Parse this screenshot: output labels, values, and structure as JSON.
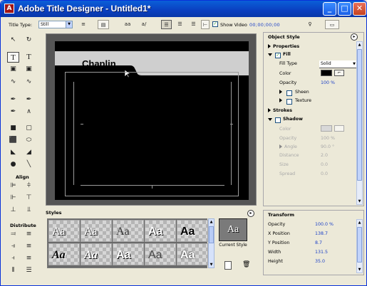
{
  "window": {
    "title": "Adobe Title Designer - Untitled1*",
    "app_icon": "adobe-icon",
    "controls": [
      "_",
      "□",
      "✕"
    ]
  },
  "toolbar": {
    "title_type_label": "Title Type:",
    "title_type_value": "Still",
    "show_video_label": "Show Video",
    "show_video_checked": true,
    "timecode": "00;00;00;00",
    "icons": [
      "roll-crawl-icon",
      "template-icon",
      "font-browse-icon",
      "kerning-icon",
      "align-left-icon",
      "align-center-icon",
      "align-right-icon",
      "tab-stops-icon",
      "light-bulb-icon",
      "export-icon"
    ]
  },
  "tools": {
    "align_label": "Align",
    "distribute_label": "Distribute",
    "items": [
      "selection-tool-icon",
      "rotation-tool-icon",
      "type-tool-icon",
      "vertical-type-tool-icon",
      "area-type-tool-icon",
      "vertical-area-type-tool-icon",
      "path-type-tool-icon",
      "vertical-path-type-tool-icon",
      "pen-tool-icon",
      "add-anchor-tool-icon",
      "delete-anchor-tool-icon",
      "convert-anchor-tool-icon",
      "rectangle-tool-icon",
      "rounded-rectangle-tool-icon",
      "clipped-corner-tool-icon",
      "rounded-corner-tool-icon",
      "wedge-tool-icon",
      "arc-tool-icon",
      "ellipse-tool-icon",
      "line-tool-icon"
    ]
  },
  "canvas": {
    "text": "Chaplin",
    "background": "#000000",
    "strip_color": "#cfcfcf"
  },
  "styles": {
    "label": "Styles",
    "swatches": [
      "Aa",
      "Aa",
      "Aa",
      "Aa",
      "Aa",
      "Aa",
      "Aa",
      "Aa",
      "Aa",
      "Aa"
    ],
    "current_style_label": "Current Style",
    "current_style_sample": "Aa"
  },
  "object_style": {
    "label": "Object Style",
    "properties_label": "Properties",
    "fill_label": "Fill",
    "fill_checked": true,
    "fill_type_label": "Fill Type",
    "fill_type_value": "Solid",
    "color_label": "Color",
    "color_value": "#000000",
    "opacity_label": "Opacity",
    "opacity_value": "100 %",
    "sheen_label": "Sheen",
    "texture_label": "Texture",
    "strokes_label": "Strokes",
    "shadow_label": "Shadow",
    "shadow_checked": false,
    "shadow_color_label": "Color",
    "shadow_opacity_label": "Opacity",
    "shadow_opacity_value": "100 %",
    "shadow_angle_label": "Angle",
    "shadow_angle_value": "90.0 °",
    "shadow_distance_label": "Distance",
    "shadow_distance_value": "2.0",
    "shadow_size_label": "Size",
    "shadow_size_value": "0.0",
    "shadow_spread_label": "Spread",
    "shadow_spread_value": "0.0"
  },
  "transform": {
    "label": "Transform",
    "rows": [
      {
        "label": "Opacity",
        "value": "100.0 %"
      },
      {
        "label": "X Position",
        "value": "138.7"
      },
      {
        "label": "Y Position",
        "value": "8.7"
      },
      {
        "label": "Width",
        "value": "131.5"
      },
      {
        "label": "Height",
        "value": "35.0"
      }
    ]
  },
  "colors": {
    "title_bar": "#0a4fd0",
    "link_blue": "#1a3fc7",
    "panel_bg": "#ece9d8"
  }
}
